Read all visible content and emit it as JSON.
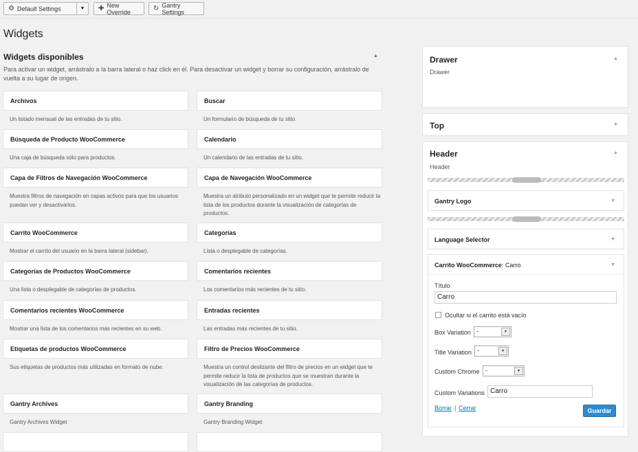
{
  "toolbar": {
    "settings_label": "Default Settings",
    "new_override_label": "New Override",
    "gantry_settings_label": "Gantry Settings"
  },
  "page": {
    "title": "Widgets"
  },
  "available": {
    "title": "Widgets disponibles",
    "description": "Para activar un widget, arrástralo a la barra lateral o haz click en él. Para desactivar un widget y borrar su configuración, arrástralo de vuelta a su lugar de origen.",
    "widgets": [
      {
        "name": "Archivos",
        "desc": "Un listado mensual de las entradas de tu sitio."
      },
      {
        "name": "Buscar",
        "desc": "Un formulario de búsqueda de tu sitio."
      },
      {
        "name": "Búsqueda de Producto WooCommerce",
        "desc": "Una caja de búsqueda sólo para productos."
      },
      {
        "name": "Calendario",
        "desc": "Un calendario de las entradas de tu sitio."
      },
      {
        "name": "Capa de Filtros de Navegación WooCommerce",
        "desc": "Muestra filtros de navegación en capas activos para que los usuarios puedan ver y desactivarlos."
      },
      {
        "name": "Capa de Navegación WooCommerce",
        "desc": "Muestra un atributo personalizado en un widget que te permite reducir la lista de los productos durante la visualización de categorías de productos."
      },
      {
        "name": "Carrito WooCommerce",
        "desc": "Mostrar el carrito del usuario en la barra lateral (sidebar)."
      },
      {
        "name": "Categorías",
        "desc": "Lista o desplegable de categorías."
      },
      {
        "name": "Categorías de Productos WooCommerce",
        "desc": "Una lista o desplegable de categorías de productos."
      },
      {
        "name": "Comentarios recientes",
        "desc": "Los comentarios más recientes de tu sitio."
      },
      {
        "name": "Comentarios recientes WooCommerce",
        "desc": "Mostrar una lista de los comentarios más recientes en su web."
      },
      {
        "name": "Entradas recientes",
        "desc": "Las entradas más recientes de tu sitio."
      },
      {
        "name": "Etiquetas de productos WooCommerce",
        "desc": "Sus etiquetas de productos más utilizadas en formato de nube."
      },
      {
        "name": "Filtro de Precios WooCommerce",
        "desc": "Muestra un control deslizante del filtro de precios en un widget que te permite reducir la lista de productos que se muestran durante la visualización de las categorías de productos."
      },
      {
        "name": "Gantry Archives",
        "desc": "Gantry Archives Widget"
      },
      {
        "name": "Gantry Branding",
        "desc": "Gantry Branding Widget"
      }
    ]
  },
  "sidebars": {
    "drawer": {
      "title": "Drawer",
      "sub": "Drawer"
    },
    "top": {
      "title": "Top"
    },
    "header": {
      "title": "Header",
      "sub": "Header"
    }
  },
  "header_widgets": {
    "gantry_logo": "Gantry Logo",
    "language_selector": "Language Selector",
    "cart_name": "Carrito WooCommerce",
    "cart_instance": ": Carro"
  },
  "cart_form": {
    "title_label": "Título",
    "title_value": "Carro",
    "hide_label": "Ocultar si el carrito está vacío",
    "box_variation_label": "Box Variation",
    "box_variation_value": "-",
    "title_variation_label": "Title Variation",
    "title_variation_value": "-",
    "custom_chrome_label": "Custom Chrome",
    "custom_chrome_value": "-",
    "custom_variations_label": "Custom Variations",
    "custom_variations_value": "Carro",
    "delete_label": "Borrar",
    "separator": "|",
    "close_label": "Cerrar",
    "save_label": "Guardar"
  }
}
